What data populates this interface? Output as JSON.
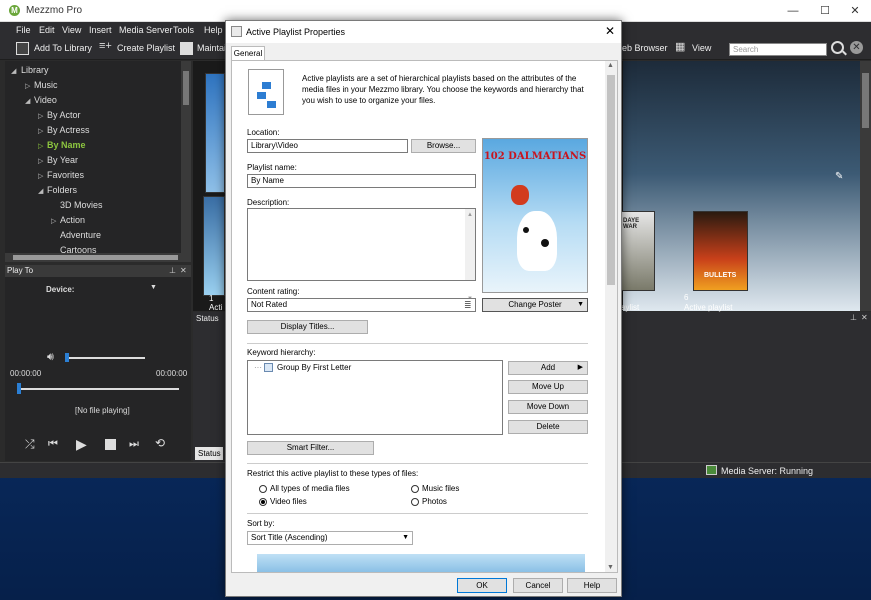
{
  "app": {
    "title": "Mezzmo Pro",
    "logo_letter": "M",
    "window_buttons": [
      "—",
      "☐",
      "✕"
    ]
  },
  "menu": [
    "File",
    "Edit",
    "View",
    "Insert",
    "Media Server",
    "Tools",
    "Help"
  ],
  "toolbar": {
    "add_to_library": "Add To Library",
    "create_playlist": "Create Playlist",
    "maintain": "Maintai",
    "web_browser": "eb Browser",
    "view": "View",
    "search_placeholder": "Search"
  },
  "tree": {
    "items": [
      {
        "label": "Library",
        "arrow": "◢"
      },
      {
        "label": "Music",
        "arrow": "▷"
      },
      {
        "label": "Video",
        "arrow": "◢"
      },
      {
        "label": "By Actor",
        "arrow": "▷"
      },
      {
        "label": "By Actress",
        "arrow": "▷"
      },
      {
        "label": "By Name",
        "arrow": "▷"
      },
      {
        "label": "By Year",
        "arrow": "▷"
      },
      {
        "label": "Favorites",
        "arrow": "▷"
      },
      {
        "label": "Folders",
        "arrow": "◢"
      },
      {
        "label": "3D Movies",
        "arrow": ""
      },
      {
        "label": "Action",
        "arrow": "▷"
      },
      {
        "label": "Adventure",
        "arrow": ""
      },
      {
        "label": "Cartoons",
        "arrow": ""
      }
    ]
  },
  "play_to": {
    "title": "Play To",
    "device_label": "Device:",
    "time_start": "00:00:00",
    "time_end": "00:00:00",
    "now_playing": "[No file playing]"
  },
  "content": {
    "tile1_num": "1",
    "tile1_label": "Acti",
    "tile2_num": "6",
    "tile2_label": "Active playlist",
    "tile3_label": "aylist",
    "poster_text_1": "DAYE WAR",
    "poster_text_2": "BULLETS"
  },
  "status_panel": {
    "title": "Status",
    "tab": "Status"
  },
  "status_bar": {
    "server": "Media Server: Running"
  },
  "dialog": {
    "title": "Active Playlist Properties",
    "tab": "General",
    "description": "Active playlists are a set of hierarchical playlists based on the attributes of the media files in your Mezzmo library. You choose the keywords and hierarchy that you wish to use to organize your files.",
    "location_label": "Location:",
    "location_value": "Library\\Video",
    "browse": "Browse...",
    "name_label": "Playlist name:",
    "name_value": "By Name",
    "desc_label": "Description:",
    "rating_label": "Content rating:",
    "rating_value": "Not Rated",
    "change_poster": "Change Poster",
    "display_titles": "Display Titles...",
    "poster_title": "102 DALMATIANS",
    "keyword_label": "Keyword hierarchy:",
    "keyword_item": "Group By First Letter",
    "add": "Add",
    "move_up": "Move Up",
    "move_down": "Move Down",
    "delete": "Delete",
    "smart_filter": "Smart Filter...",
    "restrict_label": "Restrict this active playlist to these types of files:",
    "radio_all": "All types of media files",
    "radio_music": "Music files",
    "radio_video": "Video files",
    "radio_photos": "Photos",
    "sort_label": "Sort by:",
    "sort_value": "Sort Title (Ascending)",
    "ok": "OK",
    "cancel": "Cancel",
    "help": "Help"
  }
}
